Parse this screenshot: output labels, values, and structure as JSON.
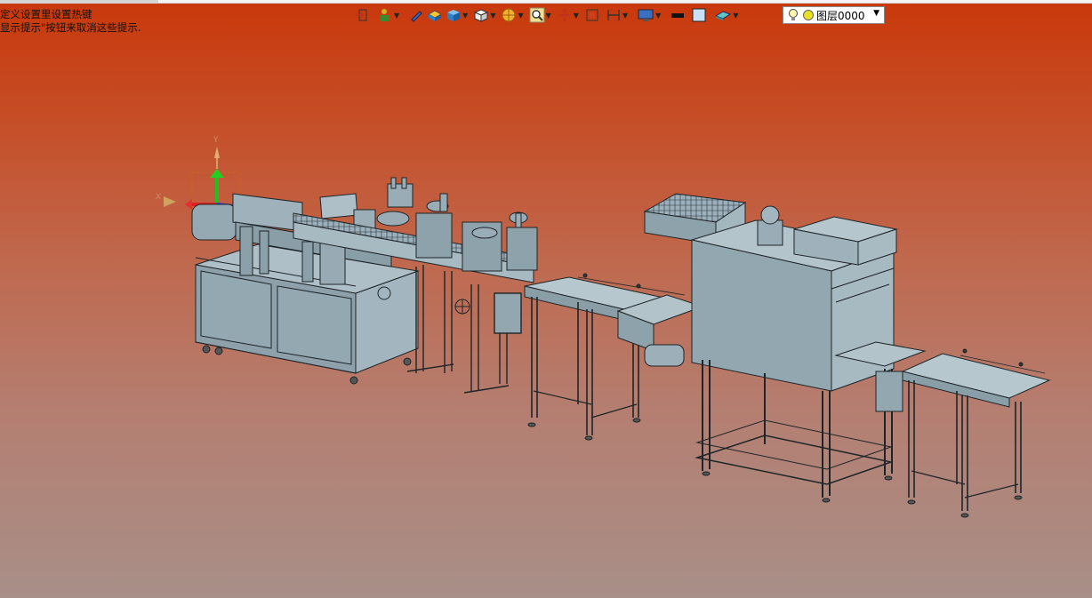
{
  "hint": {
    "line1": "定义设置里设置热键",
    "line2": "显示提示\"按钮来取消这些提示."
  },
  "layer": {
    "name": "图层0000"
  },
  "triad": {
    "x": "X",
    "y": "Y"
  },
  "colors": {
    "background_top": "#c9380b",
    "background_bottom": "#a88f88",
    "machine_fill": "#8fa3ae",
    "machine_edge": "#1e2528"
  },
  "toolbar": {
    "icons": [
      "exit-icon",
      "person-icon",
      "pencil-icon",
      "box-yellow-icon",
      "cube-blue-icon",
      "cube-white-icon",
      "sphere-icon",
      "zoom-icon",
      "pan-icon",
      "fit-icon",
      "section-icon",
      "display-icon",
      "color-black-icon",
      "color-swatch-icon",
      "plane-icon",
      "lightbulb-icon",
      "layer-yellow-icon"
    ]
  }
}
